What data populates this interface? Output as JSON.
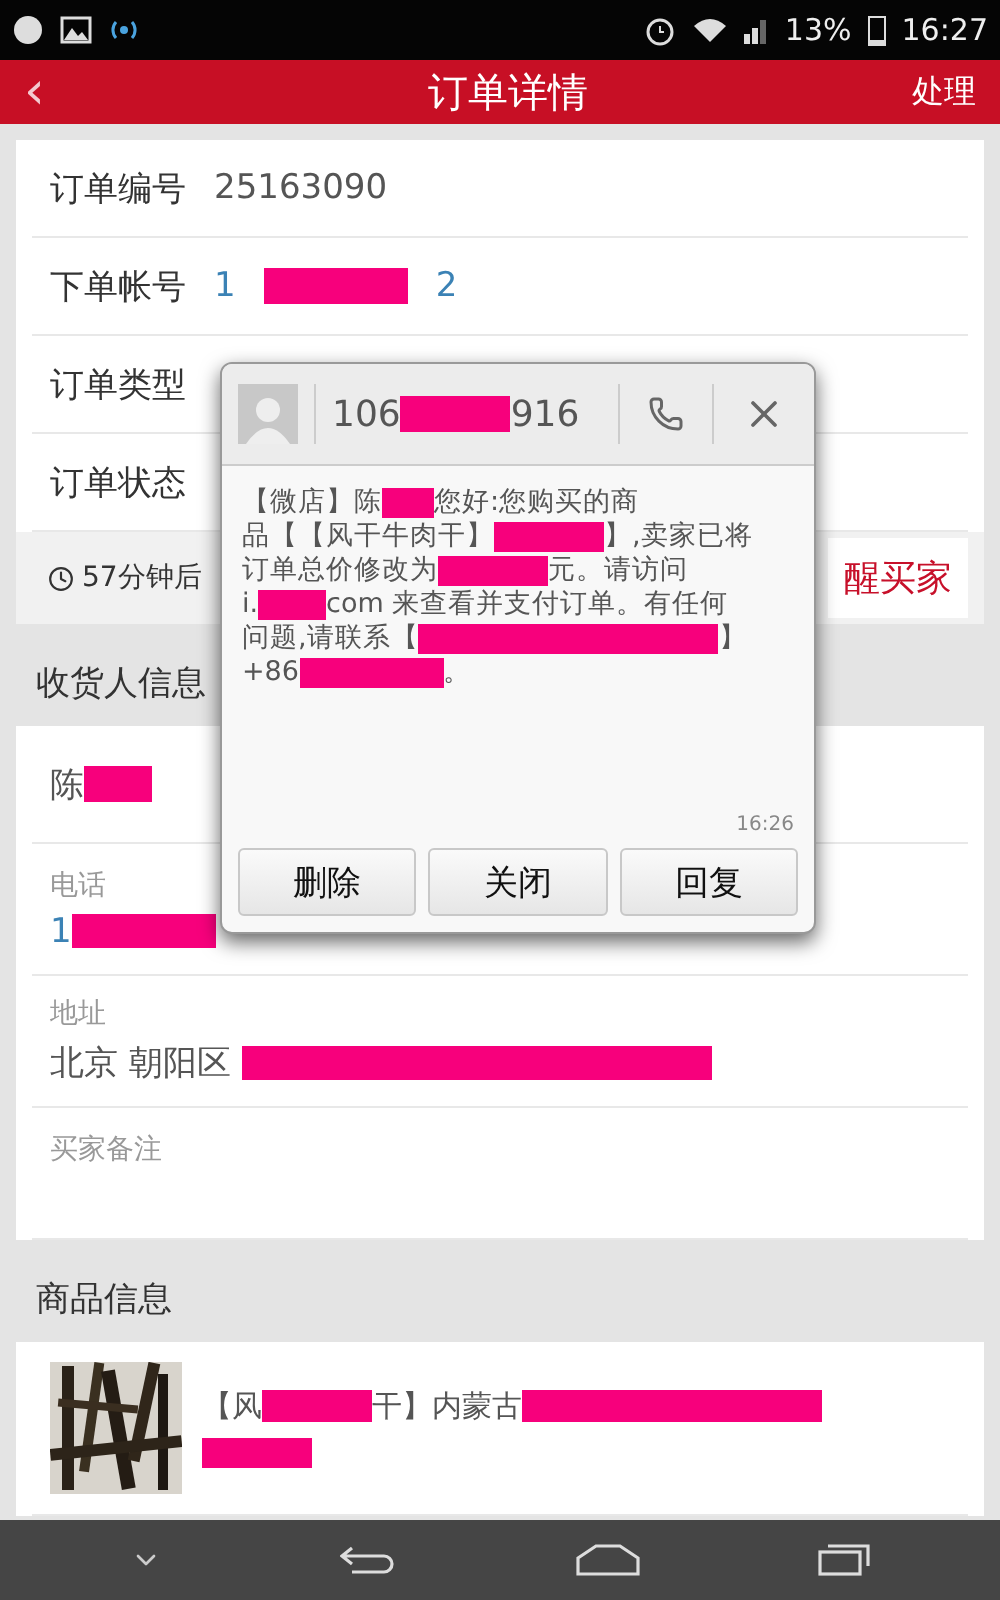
{
  "status_bar": {
    "battery": "13%",
    "time": "16:27"
  },
  "header": {
    "back": "‹",
    "title": "订单详情",
    "action": "处理"
  },
  "order_rows": [
    {
      "label": "订单编号",
      "value": [
        {
          "kind": "text",
          "text": "25163090"
        }
      ],
      "link": false
    },
    {
      "label": "下单帐号",
      "value": [
        {
          "kind": "text",
          "text": "1"
        },
        {
          "kind": "mask_l"
        },
        {
          "kind": "text",
          "text": "2"
        }
      ],
      "link": true
    },
    {
      "label": "订单类型"
    },
    {
      "label": "订单状态"
    }
  ],
  "countdown": {
    "text": "57分钟后",
    "button": "醒买家"
  },
  "recipient": {
    "title": "收货人信息",
    "name": [
      {
        "kind": "text",
        "text": "陈"
      },
      {
        "kind": "mask_s"
      }
    ],
    "fields": [
      {
        "label": "电话",
        "value": [
          {
            "kind": "text",
            "text": "1"
          },
          {
            "kind": "mask_l"
          }
        ],
        "link": true
      },
      {
        "label": "地址",
        "value": [
          {
            "kind": "text",
            "text": "北京 朝阳区 "
          },
          {
            "kind": "mask_xxl"
          }
        ],
        "link": false
      },
      {
        "label": "买家备注"
      }
    ]
  },
  "goods": {
    "title": "商品信息",
    "items": [
      {
        "image": {
          "kind": "picture"
        },
        "title": [
          {
            "kind": "text",
            "text": "【风"
          },
          {
            "kind": "mask_m"
          },
          {
            "kind": "text",
            "text": "干】内蒙古"
          },
          {
            "kind": "mask_xl"
          },
          {
            "kind": "mask_m"
          }
        ]
      }
    ]
  },
  "sms_popup": {
    "sender": [
      {
        "kind": "text",
        "text": "106"
      },
      {
        "kind": "mask_m"
      },
      {
        "kind": "text",
        "text": "916"
      }
    ],
    "message": [
      [
        {
          "kind": "text",
          "text": "【微店】陈"
        },
        {
          "kind": "mask_xs"
        },
        {
          "kind": "text",
          "text": "您好:您购买的商"
        }
      ],
      [
        {
          "kind": "text",
          "text": "品【【风干牛肉干】"
        },
        {
          "kind": "mask_m"
        },
        {
          "kind": "text",
          "text": "】,卖家已将"
        }
      ],
      [
        {
          "kind": "text",
          "text": "订单总价修改为"
        },
        {
          "kind": "mask_m"
        },
        {
          "kind": "text",
          "text": "元。请访问"
        }
      ],
      [
        {
          "kind": "text",
          "text": "i."
        },
        {
          "kind": "mask_s"
        },
        {
          "kind": "text",
          "text": "com 来查看并支付订单。有任何"
        }
      ],
      [
        {
          "kind": "text",
          "text": "问题,请联系【"
        },
        {
          "kind": "mask_xl"
        },
        {
          "kind": "text",
          "text": "】"
        }
      ],
      [
        {
          "kind": "text",
          "text": "+86"
        },
        {
          "kind": "mask_l"
        },
        {
          "kind": "text",
          "text": "。"
        }
      ]
    ],
    "time": "16:26",
    "buttons": [
      "删除",
      "关闭",
      "回复"
    ]
  }
}
